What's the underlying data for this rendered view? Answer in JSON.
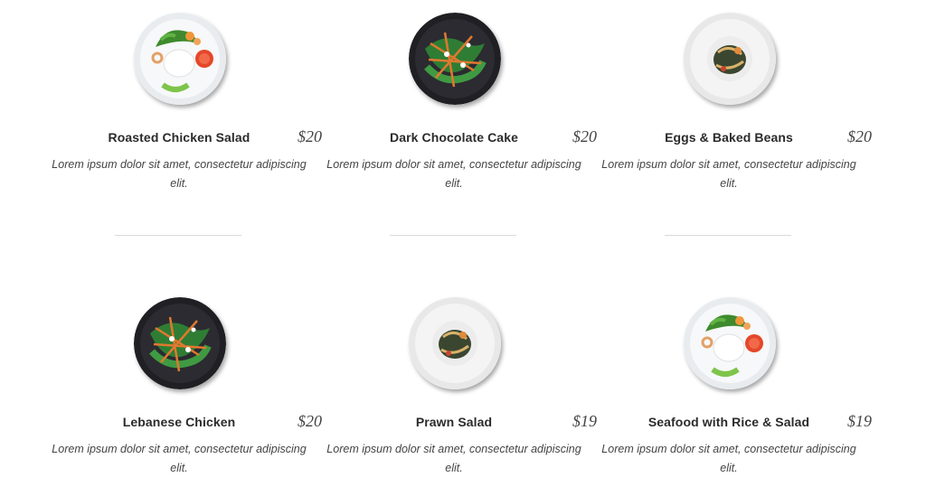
{
  "menu": {
    "items": [
      {
        "name": "Roasted Chicken Salad",
        "price": "$20",
        "description": "Lorem ipsum dolor sit amet, consectetur adipiscing elit.",
        "plate": "white",
        "dish": "shrimp-rice"
      },
      {
        "name": "Dark Chocolate Cake",
        "price": "$20",
        "description": "Lorem ipsum dolor sit amet, consectetur adipiscing elit.",
        "plate": "black",
        "dish": "green-salad"
      },
      {
        "name": "Eggs & Baked Beans",
        "price": "$20",
        "description": "Lorem ipsum dolor sit amet, consectetur adipiscing elit.",
        "plate": "white",
        "dish": "pasta"
      },
      {
        "name": "Lebanese Chicken",
        "price": "$20",
        "description": "Lorem ipsum dolor sit amet, consectetur adipiscing elit.",
        "plate": "black",
        "dish": "green-salad"
      },
      {
        "name": "Prawn Salad",
        "price": "$19",
        "description": "Lorem ipsum dolor sit amet, consectetur adipiscing elit.",
        "plate": "white",
        "dish": "pasta"
      },
      {
        "name": "Seafood with Rice & Salad",
        "price": "$19",
        "description": "Lorem ipsum dolor sit amet, consectetur adipiscing elit.",
        "plate": "white",
        "dish": "shrimp-rice"
      }
    ]
  }
}
